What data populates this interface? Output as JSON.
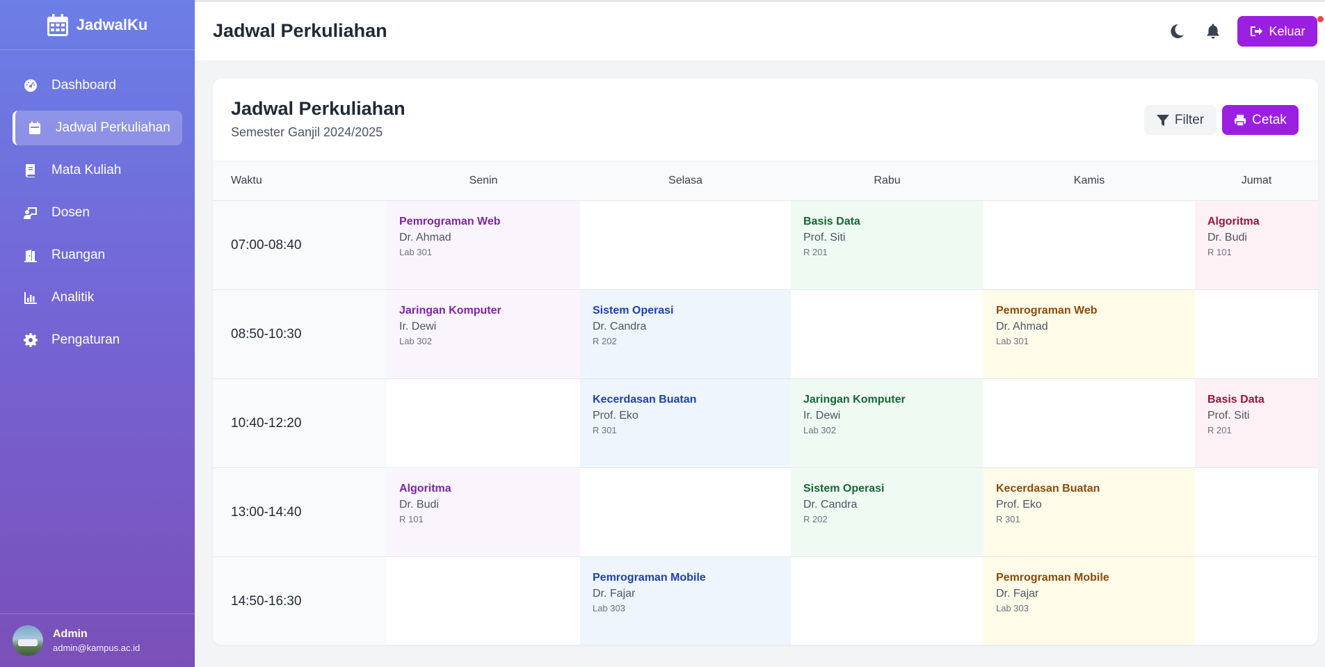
{
  "brand": {
    "name": "JadwalKu",
    "icon": "calendar-icon"
  },
  "sidebar": {
    "items": [
      {
        "label": "Dashboard",
        "icon": "gauge-icon"
      },
      {
        "label": "Jadwal Perkuliahan",
        "icon": "calendar-icon",
        "active": true
      },
      {
        "label": "Mata Kuliah",
        "icon": "book-icon"
      },
      {
        "label": "Dosen",
        "icon": "teacher-icon"
      },
      {
        "label": "Ruangan",
        "icon": "door-icon"
      },
      {
        "label": "Analitik",
        "icon": "chart-icon"
      },
      {
        "label": "Pengaturan",
        "icon": "gear-icon"
      }
    ]
  },
  "user": {
    "name": "Admin",
    "email": "admin@kampus.ac.id"
  },
  "header": {
    "title": "Jadwal Perkuliahan",
    "logout_label": "Keluar"
  },
  "card": {
    "title": "Jadwal Perkuliahan",
    "subtitle": "Semester Ganjil 2024/2025",
    "filter_label": "Filter",
    "print_label": "Cetak"
  },
  "colors": {
    "accent": "#9b1fe0",
    "sidebar_top": "#6b7fe6",
    "sidebar_bottom": "#7a4fb8"
  },
  "table": {
    "columns": [
      "Waktu",
      "Senin",
      "Selasa",
      "Rabu",
      "Kamis",
      "Jumat"
    ],
    "rows": [
      {
        "time": "07:00-08:40",
        "cells": [
          {
            "course": "Pemrograman Web",
            "lecturer": "Dr. Ahmad",
            "room": "Lab 301",
            "color": "purple"
          },
          null,
          {
            "course": "Basis Data",
            "lecturer": "Prof. Siti",
            "room": "R 201",
            "color": "green"
          },
          null,
          {
            "course": "Algoritma",
            "lecturer": "Dr. Budi",
            "room": "R 101",
            "color": "pink"
          }
        ]
      },
      {
        "time": "08:50-10:30",
        "cells": [
          {
            "course": "Jaringan Komputer",
            "lecturer": "Ir. Dewi",
            "room": "Lab 302",
            "color": "purple"
          },
          {
            "course": "Sistem Operasi",
            "lecturer": "Dr. Candra",
            "room": "R 202",
            "color": "blue"
          },
          null,
          {
            "course": "Pemrograman Web",
            "lecturer": "Dr. Ahmad",
            "room": "Lab 301",
            "color": "yellow"
          },
          null
        ]
      },
      {
        "time": "10:40-12:20",
        "cells": [
          null,
          {
            "course": "Kecerdasan Buatan",
            "lecturer": "Prof. Eko",
            "room": "R 301",
            "color": "blue"
          },
          {
            "course": "Jaringan Komputer",
            "lecturer": "Ir. Dewi",
            "room": "Lab 302",
            "color": "green"
          },
          null,
          {
            "course": "Basis Data",
            "lecturer": "Prof. Siti",
            "room": "R 201",
            "color": "pink"
          }
        ]
      },
      {
        "time": "13:00-14:40",
        "cells": [
          {
            "course": "Algoritma",
            "lecturer": "Dr. Budi",
            "room": "R 101",
            "color": "purple"
          },
          null,
          {
            "course": "Sistem Operasi",
            "lecturer": "Dr. Candra",
            "room": "R 202",
            "color": "green"
          },
          {
            "course": "Kecerdasan Buatan",
            "lecturer": "Prof. Eko",
            "room": "R 301",
            "color": "yellow"
          },
          null
        ]
      },
      {
        "time": "14:50-16:30",
        "cells": [
          null,
          {
            "course": "Pemrograman Mobile",
            "lecturer": "Dr. Fajar",
            "room": "Lab 303",
            "color": "blue"
          },
          null,
          {
            "course": "Pemrograman Mobile",
            "lecturer": "Dr. Fajar",
            "room": "Lab 303",
            "color": "yellow"
          },
          null
        ]
      }
    ]
  }
}
